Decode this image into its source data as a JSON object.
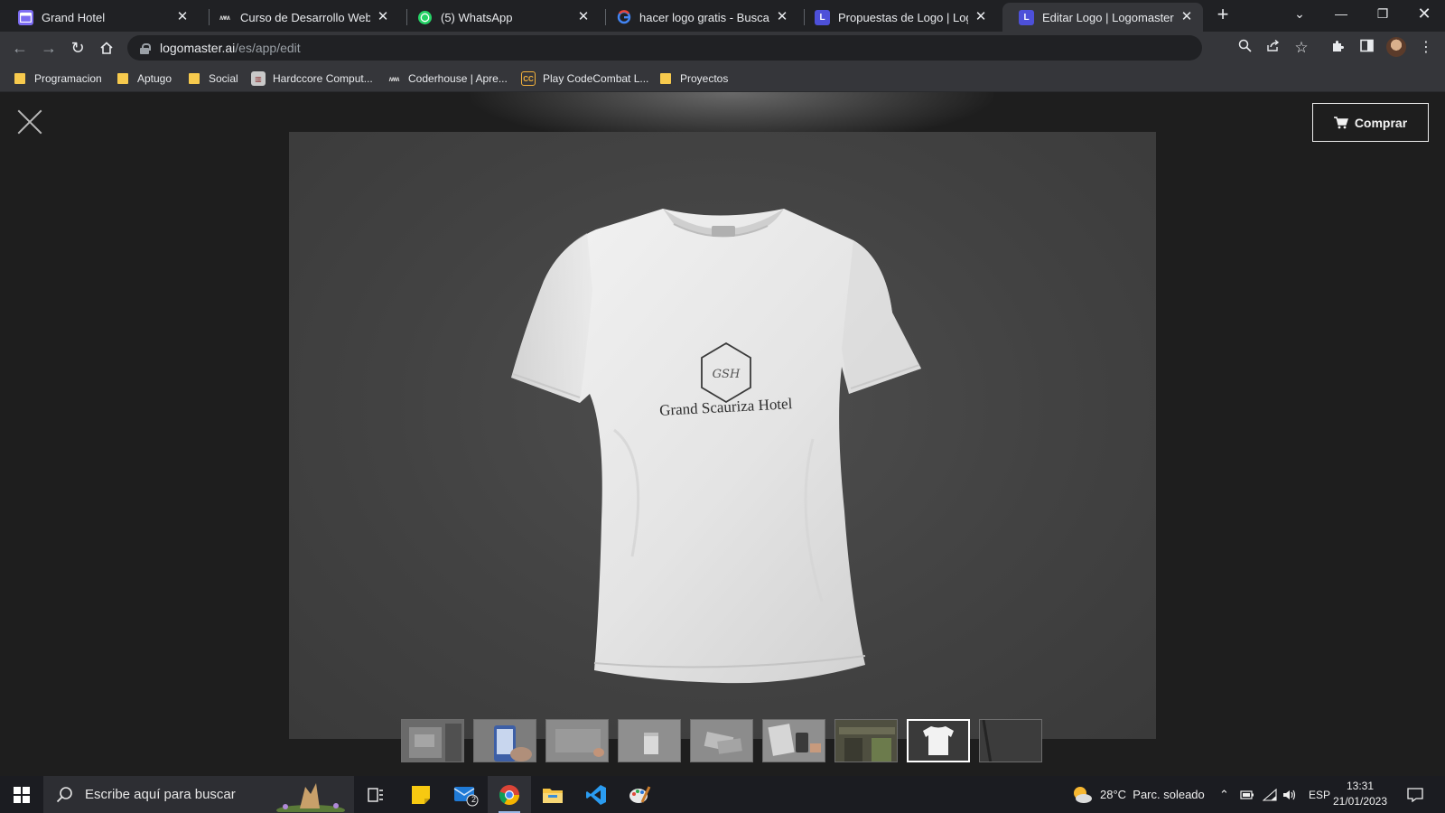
{
  "browser": {
    "tabs": [
      {
        "title": "Grand Hotel",
        "favicon": "calendar-icon",
        "color": "#7c6cf2",
        "active": false
      },
      {
        "title": "Curso de Desarrollo Web | Pla",
        "favicon": "coderhouse-icon",
        "color": "#dddddd",
        "active": false
      },
      {
        "title": "(5) WhatsApp",
        "favicon": "whatsapp-icon",
        "color": "#25d366",
        "active": false
      },
      {
        "title": "hacer logo gratis - Buscar con",
        "favicon": "google-icon",
        "color": "#ffffff",
        "active": false
      },
      {
        "title": "Propuestas de Logo | Logoma",
        "favicon": "logomaster-icon",
        "color": "#4d50d9",
        "active": false
      },
      {
        "title": "Editar Logo | Logomaster: On",
        "favicon": "logomaster-icon",
        "color": "#4d50d9",
        "active": true
      }
    ],
    "url_host": "logomaster.ai",
    "url_path": "/es/app/edit",
    "bookmarks": [
      {
        "label": "Programacion",
        "type": "folder"
      },
      {
        "label": "Aptugo",
        "type": "folder"
      },
      {
        "label": "Social",
        "type": "folder"
      },
      {
        "label": "Hardccore Comput...",
        "type": "site"
      },
      {
        "label": "Coderhouse | Apre...",
        "type": "site"
      },
      {
        "label": "Play CodeCombat L...",
        "type": "site"
      },
      {
        "label": "Proyectos",
        "type": "folder"
      }
    ]
  },
  "page": {
    "buy_label": "Comprar",
    "logo": {
      "monogram": "GSH",
      "brand_name": "Grand Scauriza Hotel"
    },
    "thumbnails": [
      {
        "name": "building-sign-mockup",
        "selected": false
      },
      {
        "name": "phone-app-mockup",
        "selected": false
      },
      {
        "name": "wall-sign-mockup",
        "selected": false
      },
      {
        "name": "paper-bag-mockup",
        "selected": false
      },
      {
        "name": "business-card-mockup",
        "selected": false
      },
      {
        "name": "stationery-mockup",
        "selected": false
      },
      {
        "name": "storefront-mockup",
        "selected": false
      },
      {
        "name": "tshirt-mockup",
        "selected": true
      },
      {
        "name": "dark-mockup",
        "selected": false
      }
    ]
  },
  "taskbar": {
    "search_placeholder": "Escribe aquí para buscar",
    "mail_badge": "2",
    "weather": "28°C  Parc. soleado",
    "language": "ESP",
    "time": "13:31",
    "date": "21/01/2023"
  },
  "colors": {
    "accent_logomaster": "#4d50d9",
    "page_background": "#1e1e1e",
    "mockup_background": "#444444"
  }
}
